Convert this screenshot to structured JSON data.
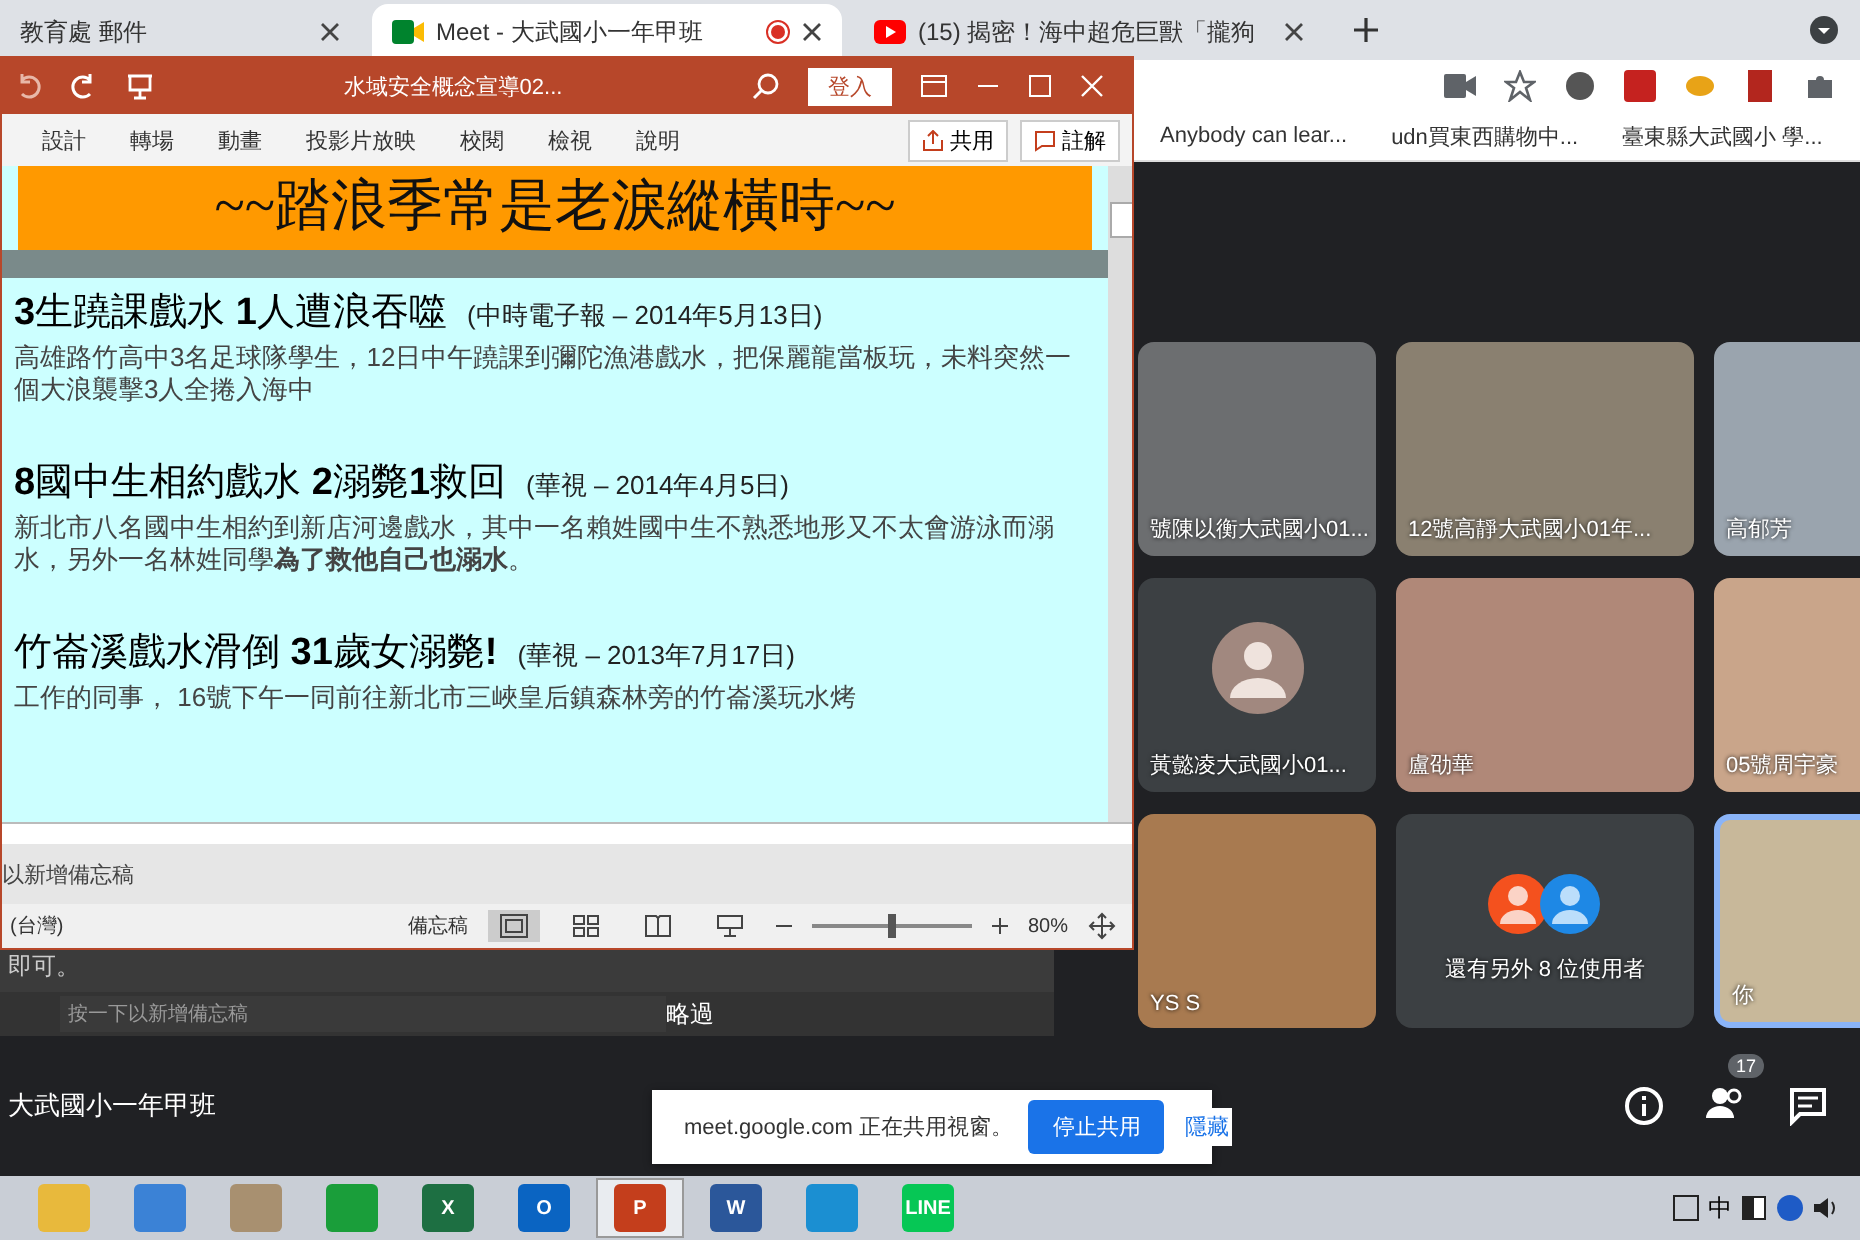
{
  "browser": {
    "tabs": [
      {
        "title": "教育處 郵件",
        "kind": "mail",
        "selected": false
      },
      {
        "title": "Meet - 大武國小一年甲班",
        "kind": "meet",
        "selected": true
      },
      {
        "title": "(15) 揭密！海中超危巨獸「攏狗",
        "kind": "video",
        "selected": false
      }
    ],
    "bookmarks": [
      "Anybody can lear...",
      "udn買東西購物中...",
      "臺東縣大武國小 學..."
    ]
  },
  "powerpoint": {
    "title": "水域安全概念宣導02...",
    "sign_in": "登入",
    "ribbon_tabs": [
      "設計",
      "轉場",
      "動畫",
      "投影片放映",
      "校閱",
      "檢視",
      "說明"
    ],
    "share": "共用",
    "comment": "註解",
    "slide": {
      "title": "~~踏浪季常是老淚縱橫時~~",
      "stories": [
        {
          "headline": "**3**生蹺課戲水 **1**人遭浪吞噬",
          "source": "(中時電子報 – 2014年5月13日)",
          "body": "高雄路竹高中3名足球隊學生，12日中午蹺課到彌陀漁港戲水，把保麗龍當板玩，未料突然一個大浪襲擊3人全捲入海中"
        },
        {
          "headline": "**8**國中生相約戲水 **2**溺斃**1**救回",
          "source": "(華視 – 2014年4月5日)",
          "body": "新北市八名國中生相約到新店河邊戲水，其中一名賴姓國中生不熟悉地形又不太會游泳而溺水，另外一名林姓同學**為了救他自己也溺水**。"
        },
        {
          "headline": "竹崙溪戲水滑倒 **31**歲女溺斃**!**",
          "source": "(華視 – 2013年7月17日)",
          "body": "工作的同事， 16號下午一同前往新北市三峽皇后鎮森林旁的竹崙溪玩水烤"
        }
      ]
    },
    "notes_placeholder": "以新增備忘稿",
    "status": {
      "language": "(台灣)",
      "notes": "備忘稿",
      "zoom": {
        "level": 0.5,
        "reading": "80%"
      }
    },
    "view_buttons": [
      {
        "kind": "normal",
        "selected": true
      },
      {
        "kind": "sorter",
        "selected": false
      },
      {
        "kind": "reading",
        "selected": false
      },
      {
        "kind": "show",
        "selected": false
      }
    ]
  },
  "meet": {
    "shared_screen": {
      "text": "即可。",
      "notes": "按一下以新增備忘稿",
      "skip": "略過"
    },
    "tiles": [
      {
        "name": "號陳以衡大武國小01...",
        "kind": "video",
        "speaking": false
      },
      {
        "name": "12號高靜大武國小01年...",
        "kind": "video",
        "speaking": false
      },
      {
        "name": "高郁芳",
        "kind": "video",
        "speaking": false
      },
      {
        "name": "黃懿凌大武國小01...",
        "kind": "avatar",
        "speaking": false
      },
      {
        "name": "盧劭華",
        "kind": "video",
        "speaking": false
      },
      {
        "name": "05號周宇豪",
        "kind": "video",
        "speaking": false
      },
      {
        "name": "YS S",
        "kind": "video",
        "speaking": false
      },
      {
        "name": "還有另外 8 位使用者",
        "kind": "others",
        "speaking": false
      },
      {
        "name": "你",
        "kind": "video",
        "speaking": true
      }
    ],
    "meeting_name": "大武國小一年甲班",
    "participants_count": "17",
    "share_banner": {
      "text": "meet.google.com 正在共用視窗。",
      "stop": "停止共用",
      "hide": "隱藏"
    }
  },
  "taskbar": {
    "apps": [
      {
        "kind": "folder",
        "selected": false
      },
      {
        "kind": "chrome",
        "selected": false
      },
      {
        "kind": "tool",
        "selected": false
      },
      {
        "kind": "store",
        "selected": false
      },
      {
        "kind": "excel",
        "selected": false,
        "label": "X"
      },
      {
        "kind": "outlook",
        "selected": false,
        "label": "O"
      },
      {
        "kind": "powerpoint",
        "selected": true,
        "label": "P"
      },
      {
        "kind": "word",
        "selected": false,
        "label": "W"
      },
      {
        "kind": "edge",
        "selected": false
      },
      {
        "kind": "line",
        "selected": false,
        "label": "LINE"
      }
    ],
    "ime": "中"
  }
}
